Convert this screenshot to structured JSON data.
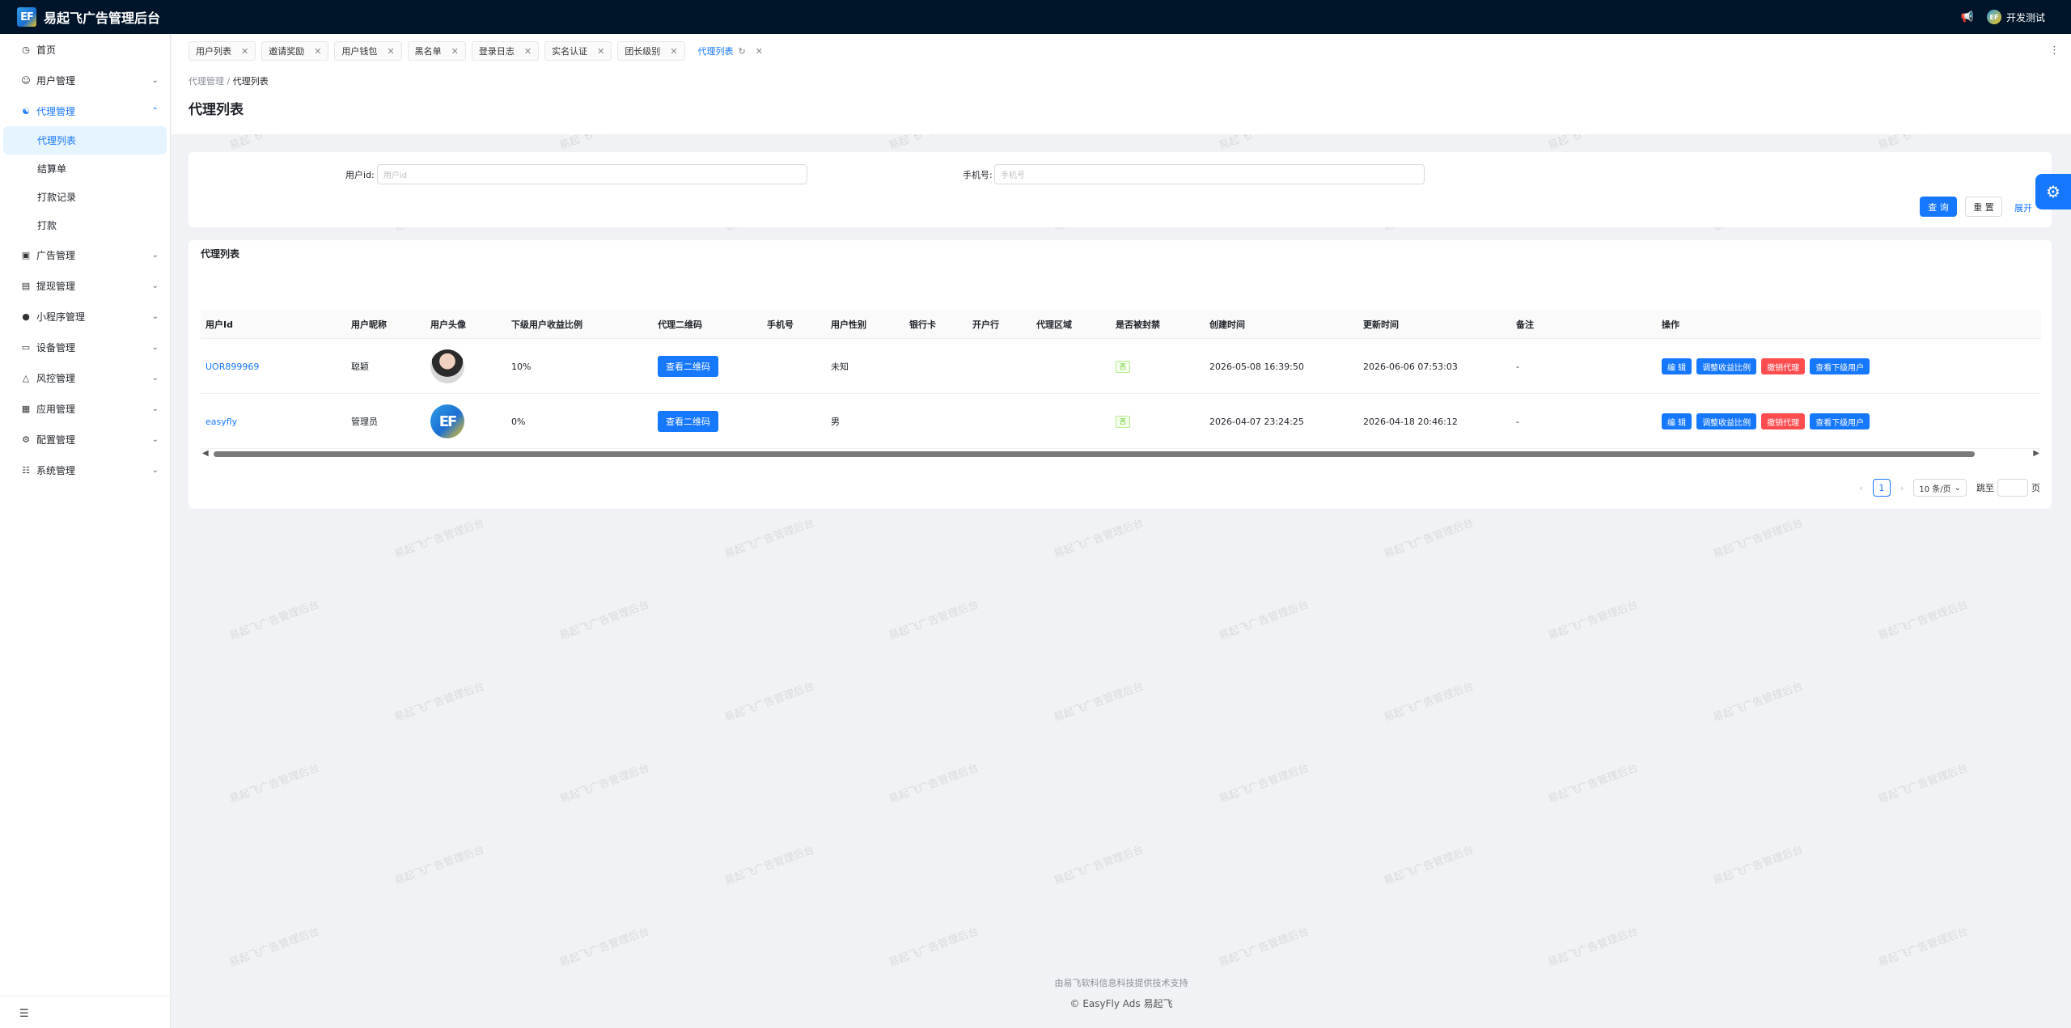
{
  "app": {
    "logo_text": "EF",
    "title": "易起飞广告管理后台",
    "user_name": "开发测试",
    "user_avatar_text": "EF"
  },
  "sidebar": {
    "items": [
      {
        "label": "首页",
        "icon": "dashboard-icon"
      },
      {
        "label": "用户管理",
        "icon": "user-icon"
      },
      {
        "label": "代理管理",
        "icon": "agent-icon",
        "open": true,
        "children": [
          {
            "label": "代理列表",
            "active": true
          },
          {
            "label": "结算单"
          },
          {
            "label": "打款记录"
          },
          {
            "label": "打款"
          }
        ]
      },
      {
        "label": "广告管理",
        "icon": "ad-icon"
      },
      {
        "label": "提现管理",
        "icon": "withdraw-icon"
      },
      {
        "label": "小程序管理",
        "icon": "wechat-icon"
      },
      {
        "label": "设备管理",
        "icon": "monitor-icon"
      },
      {
        "label": "风控管理",
        "icon": "warning-icon"
      },
      {
        "label": "应用管理",
        "icon": "app-grid-icon"
      },
      {
        "label": "配置管理",
        "icon": "gear-icon"
      },
      {
        "label": "系统管理",
        "icon": "system-icon"
      }
    ]
  },
  "tabs": [
    {
      "label": "用户列表"
    },
    {
      "label": "邀请奖励"
    },
    {
      "label": "用户钱包"
    },
    {
      "label": "黑名单"
    },
    {
      "label": "登录日志"
    },
    {
      "label": "实名认证"
    },
    {
      "label": "团长级别"
    },
    {
      "label": "代理列表",
      "active": true
    }
  ],
  "breadcrumb": {
    "parent": "代理管理",
    "separator": "/",
    "current": "代理列表"
  },
  "page_title": "代理列表",
  "filter": {
    "user_id_label": "用户id:",
    "user_id_placeholder": "用户id",
    "phone_label": "手机号:",
    "phone_placeholder": "手机号",
    "search_label": "查 询",
    "reset_label": "重 置",
    "expand_label": "展开"
  },
  "table": {
    "title": "代理列表",
    "columns": [
      "用户Id",
      "用户昵称",
      "用户头像",
      "下级用户收益比例",
      "代理二维码",
      "手机号",
      "用户性别",
      "银行卡",
      "开户行",
      "代理区域",
      "是否被封禁",
      "创建时间",
      "更新时间",
      "备注",
      "操作"
    ],
    "rows": [
      {
        "id": "UOR899969",
        "nickname": "聪颖",
        "avatar": "photo",
        "ratio": "10%",
        "qr_label": "查看二维码",
        "phone": "",
        "gender": "未知",
        "bank_card": "",
        "bank": "",
        "region": "",
        "banned": "否",
        "created": "2026-05-08 16:39:50",
        "updated": "2026-06-06 07:53:03",
        "remark": "-"
      },
      {
        "id": "easyfly",
        "nickname": "管理员",
        "avatar": "EF",
        "ratio": "0%",
        "qr_label": "查看二维码",
        "phone": "",
        "gender": "男",
        "bank_card": "",
        "bank": "",
        "region": "",
        "banned": "否",
        "created": "2026-04-07 23:24:25",
        "updated": "2026-04-18 20:46:12",
        "remark": "-"
      }
    ],
    "actions": {
      "edit": "编 辑",
      "adjust": "调整收益比例",
      "revoke": "撤销代理",
      "subordinates": "查看下级用户"
    }
  },
  "pagination": {
    "current_page": "1",
    "page_size": "10 条/页",
    "jump_label": "跳至",
    "page_suffix": "页"
  },
  "footer": {
    "line1": "由易飞软科信息科技提供技术支持",
    "line2": "© EasyFly Ads 易起飞"
  },
  "watermark": "易起飞广告管理后台",
  "colors": {
    "primary": "#1677ff",
    "danger": "#ff4d4f",
    "topbar": "#001529",
    "success": "#52c41a"
  }
}
